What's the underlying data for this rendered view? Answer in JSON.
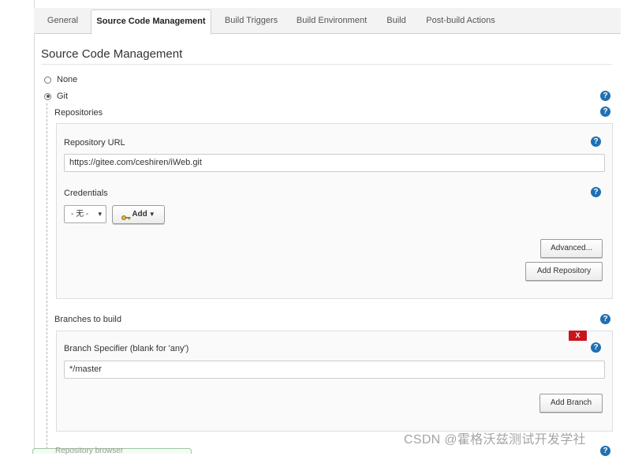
{
  "tabs": [
    {
      "label": "General"
    },
    {
      "label": "Source Code Management"
    },
    {
      "label": "Build Triggers"
    },
    {
      "label": "Build Environment"
    },
    {
      "label": "Build"
    },
    {
      "label": "Post-build Actions"
    }
  ],
  "section_title": "Source Code Management",
  "scm": {
    "none_label": "None",
    "git_label": "Git",
    "selected": "Git"
  },
  "repositories": {
    "heading": "Repositories",
    "url_label": "Repository URL",
    "url_value": "https://gitee.com/ceshiren/iWeb.git",
    "credentials_label": "Credentials",
    "credentials_selected": "- 无 -",
    "add_label": "Add",
    "advanced_label": "Advanced...",
    "add_repository_label": "Add Repository"
  },
  "branches": {
    "heading": "Branches to build",
    "delete_label": "X",
    "specifier_label": "Branch Specifier (blank for 'any')",
    "specifier_value": "*/master",
    "add_branch_label": "Add Branch"
  },
  "repository_browser_label": "Repository browser",
  "help_glyph": "?",
  "watermark": "CSDN @霍格沃兹测试开发学社",
  "colors": {
    "help_blue": "#1f6fb2",
    "delete_red": "#c8161d"
  }
}
